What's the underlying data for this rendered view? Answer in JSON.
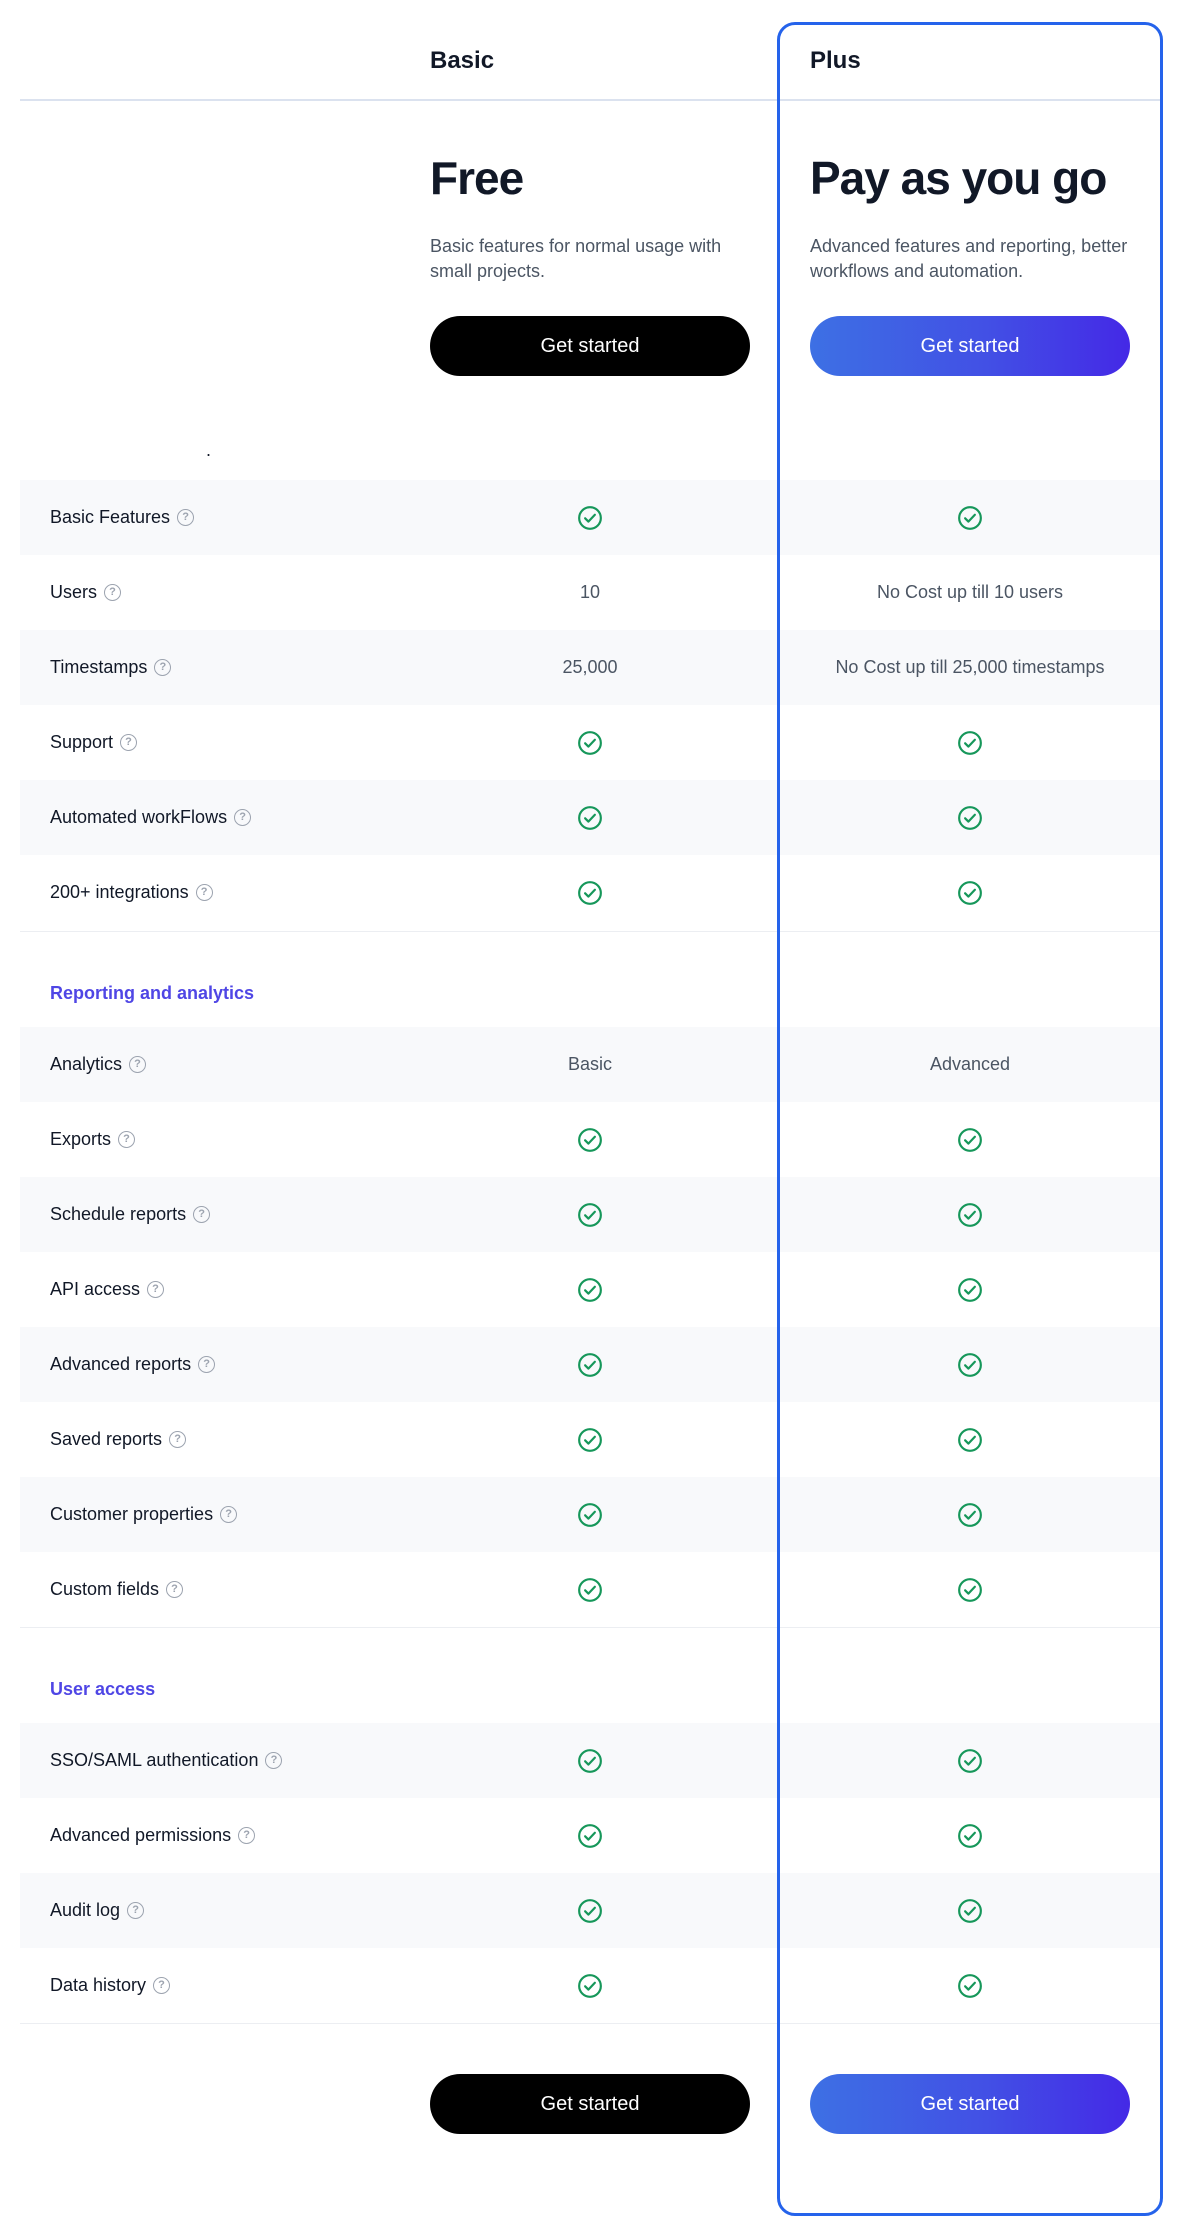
{
  "plans": [
    {
      "name": "Basic",
      "price": "Free",
      "description": "Basic features for normal usage with small projects.",
      "cta_label": "Get started",
      "highlighted": false
    },
    {
      "name": "Plus",
      "price": "Pay as you go",
      "description": "Advanced features and reporting, better workflows and automation.",
      "cta_label": "Get started",
      "highlighted": true
    }
  ],
  "stray_text": ".",
  "colors": {
    "accent": "#2563eb",
    "section_heading": "#4f46e5",
    "check": "#16975a",
    "gradient_start": "#3d70e4",
    "gradient_end": "#4429e6"
  },
  "help_icon_glyph": "?",
  "sections": [
    {
      "title": "",
      "features": [
        {
          "label": "Basic Features",
          "basic": {
            "type": "check"
          },
          "plus": {
            "type": "check"
          }
        },
        {
          "label": "Users",
          "basic": {
            "type": "text",
            "value": "10"
          },
          "plus": {
            "type": "text",
            "value": "No Cost up till 10 users"
          }
        },
        {
          "label": "Timestamps",
          "basic": {
            "type": "text",
            "value": "25,000"
          },
          "plus": {
            "type": "text",
            "value": "No Cost up till 25,000 timestamps"
          }
        },
        {
          "label": "Support",
          "basic": {
            "type": "check"
          },
          "plus": {
            "type": "check"
          }
        },
        {
          "label": "Automated workFlows",
          "basic": {
            "type": "check"
          },
          "plus": {
            "type": "check"
          }
        },
        {
          "label": "200+ integrations",
          "basic": {
            "type": "check"
          },
          "plus": {
            "type": "check"
          }
        }
      ]
    },
    {
      "title": "Reporting and analytics",
      "features": [
        {
          "label": "Analytics",
          "basic": {
            "type": "text",
            "value": "Basic"
          },
          "plus": {
            "type": "text",
            "value": "Advanced"
          }
        },
        {
          "label": "Exports",
          "basic": {
            "type": "check"
          },
          "plus": {
            "type": "check"
          }
        },
        {
          "label": "Schedule reports",
          "basic": {
            "type": "check"
          },
          "plus": {
            "type": "check"
          }
        },
        {
          "label": "API access",
          "basic": {
            "type": "check"
          },
          "plus": {
            "type": "check"
          }
        },
        {
          "label": "Advanced reports",
          "basic": {
            "type": "check"
          },
          "plus": {
            "type": "check"
          }
        },
        {
          "label": "Saved reports",
          "basic": {
            "type": "check"
          },
          "plus": {
            "type": "check"
          }
        },
        {
          "label": "Customer properties",
          "basic": {
            "type": "check"
          },
          "plus": {
            "type": "check"
          }
        },
        {
          "label": "Custom fields",
          "basic": {
            "type": "check"
          },
          "plus": {
            "type": "check"
          }
        }
      ]
    },
    {
      "title": "User access",
      "features": [
        {
          "label": "SSO/SAML authentication",
          "basic": {
            "type": "check"
          },
          "plus": {
            "type": "check"
          }
        },
        {
          "label": "Advanced permissions",
          "basic": {
            "type": "check"
          },
          "plus": {
            "type": "check"
          }
        },
        {
          "label": "Audit log",
          "basic": {
            "type": "check"
          },
          "plus": {
            "type": "check"
          }
        },
        {
          "label": "Data history",
          "basic": {
            "type": "check"
          },
          "plus": {
            "type": "check"
          }
        }
      ]
    }
  ]
}
